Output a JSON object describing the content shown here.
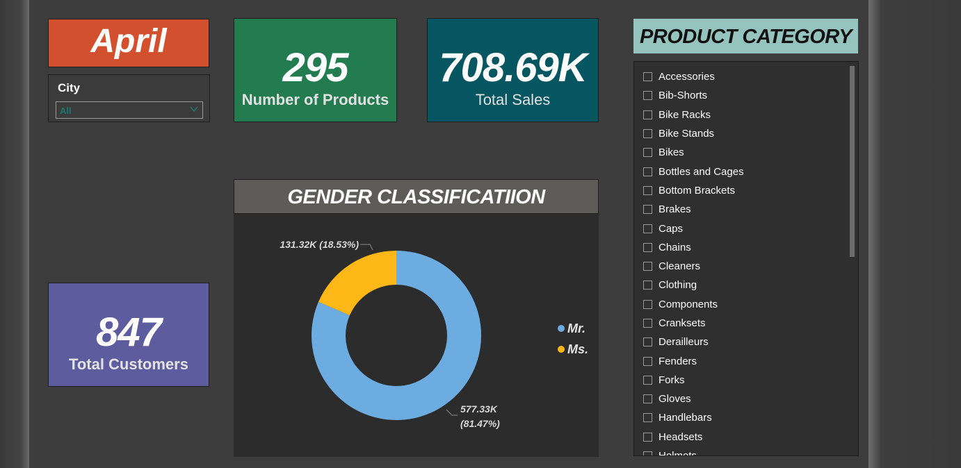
{
  "month": {
    "label": "April"
  },
  "city_filter": {
    "title": "City",
    "value": "All"
  },
  "kpis": {
    "products": {
      "value": "295",
      "label": "Number of Products",
      "color": "#237b50"
    },
    "sales": {
      "value": "708.69K",
      "label": "Total Sales",
      "color": "#055660"
    },
    "customers": {
      "value": "847",
      "label": "Total Customers",
      "color": "#5c5c9e"
    }
  },
  "gender": {
    "title": "GENDER CLASSIFICATIION",
    "legend": [
      {
        "name": "Mr.",
        "color": "#6cace0"
      },
      {
        "name": "Ms.",
        "color": "#fdb716"
      }
    ]
  },
  "chart_data": {
    "type": "pie",
    "donut": true,
    "title": "GENDER CLASSIFICATIION",
    "legend_position": "right",
    "series": [
      {
        "name": "Mr.",
        "value": 577.33,
        "percent": 81.47,
        "label_line1": "577.33K",
        "label_line2": "(81.47%)",
        "color": "#6cace0"
      },
      {
        "name": "Ms.",
        "value": 131.32,
        "percent": 18.53,
        "label_line1": "131.32K (18.53%)",
        "label_line2": "",
        "color": "#fdb716"
      }
    ]
  },
  "product_category": {
    "title": "PRODUCT CATEGORY",
    "items": [
      "Accessories",
      "Bib-Shorts",
      "Bike Racks",
      "Bike Stands",
      "Bikes",
      "Bottles and Cages",
      "Bottom Brackets",
      "Brakes",
      "Caps",
      "Chains",
      "Cleaners",
      "Clothing",
      "Components",
      "Cranksets",
      "Derailleurs",
      "Fenders",
      "Forks",
      "Gloves",
      "Handlebars",
      "Headsets",
      "Helmets"
    ]
  }
}
